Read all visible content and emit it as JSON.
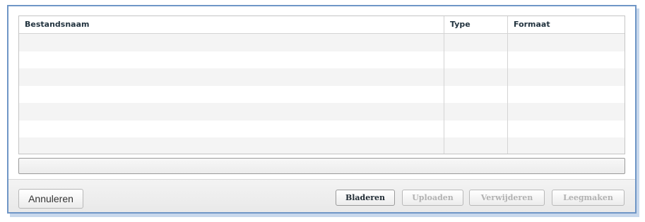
{
  "file_table": {
    "columns": [
      "Bestandsnaam",
      "Type",
      "Formaat"
    ],
    "rows": []
  },
  "progress": {
    "value": 0
  },
  "buttons": {
    "cancel": "Annuleren",
    "browse": "Bladeren",
    "upload": "Uploaden",
    "delete": "Verwijderen",
    "clear": "Leegmaken"
  },
  "colors": {
    "dialog_border": "#6f96c6",
    "header_text": "#22333f",
    "disabled_text": "#b2b2b2",
    "row_alt": "#f4f4f4"
  }
}
